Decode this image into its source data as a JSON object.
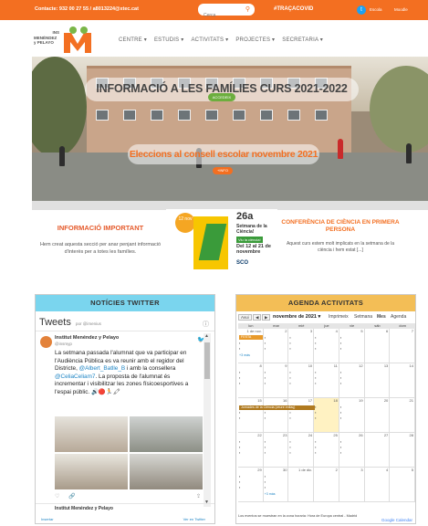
{
  "topbar": {
    "contact": "Contacte: 932 00 27 55 / a8013224@xtec.cat",
    "search_placeholder": "Cerca",
    "hashtag": "#TRAÇACOVID",
    "links": [
      "Escola",
      "Moodle"
    ]
  },
  "logo": {
    "line1": "INS",
    "line2": "MENÉNDEZ",
    "line3": "y PELAYO"
  },
  "nav": [
    "CENTRE",
    "ESTUDIS",
    "ACTIVITATS",
    "PROJECTES",
    "SECRETARIA"
  ],
  "hero": {
    "title": "INFORMACIÓ A LES FAMÍLIES CURS 2021-2022",
    "button1": "ACCEDEIX",
    "title2": "Eleccions al consell escolar novembre 2021",
    "button2": "+INFO"
  },
  "info": {
    "title": "INFORMACIÓ IMPORTANT",
    "text": "Hem creat aquesta secció per anar penjant informació d'interès per a totes les famílies."
  },
  "banner": {
    "badge": "12 nov",
    "edition": "26a",
    "line": "Setmana de la Ciència!",
    "vv": "Viu la ciència!",
    "dates": "Del 12 al 21 de novembre",
    "sponsor": "SCO"
  },
  "conf": {
    "title": "CONFERÈNCIA DE CIÈNCIA EN PRIMERA PERSONA",
    "text": "Aquest curs estem molt implicats en la setmana de la ciència i hem estat [...]"
  },
  "twitter": {
    "header": "NOTÍCIES TWITTER",
    "tweets_label": "Tweets",
    "by": "por @imenius",
    "name": "Institut Menéndez y Pelayo",
    "handle": "@insmyp",
    "text_a": "La setmana passada l'alumnat que va participar en l'Audiència Pública es va reunir amb el regidor del Districte, ",
    "link1": "@Albert_Batlle_B",
    "text_b": " i amb la consellera ",
    "link2": "@CeliaCeliam7",
    "text_c": ". La proposta de l'alumnat és incrementar i visibilitzar les zones físicoesportives a l'espai públic. 🔊🔴🏃🖍",
    "next_name": "Institut Menéndez y Pelayo",
    "footer_left": "Insertar",
    "footer_right": "Ver en Twitter"
  },
  "agenda": {
    "header": "AGENDA ACTIVITATS",
    "today": "Avui",
    "month": "novembre de 2021",
    "views": [
      "Imprimeix",
      "Setmana",
      "Mes",
      "Agenda"
    ],
    "dow": [
      "lun",
      "mar",
      "mié",
      "jue",
      "vie",
      "sáb",
      "dom"
    ],
    "weeks": [
      [
        "1 de nov.",
        "2",
        "3",
        "4",
        "5",
        "6",
        "7"
      ],
      [
        "8",
        "9",
        "10",
        "11",
        "12",
        "13",
        "14"
      ],
      [
        "15",
        "16",
        "17",
        "18",
        "19",
        "20",
        "21"
      ],
      [
        "22",
        "23",
        "24",
        "25",
        "26",
        "27",
        "28"
      ],
      [
        "29",
        "30",
        "1 de dic.",
        "2",
        "3",
        "4",
        "5"
      ]
    ],
    "bar1": "FESTA",
    "bar2": "Jornades de la Ciència (veure enllaç)",
    "more": "+3 más",
    "footer": "Los eventos se muestran en la zona horaria: Hora de Europa central - Madrid",
    "gc": "Google Calendar"
  }
}
